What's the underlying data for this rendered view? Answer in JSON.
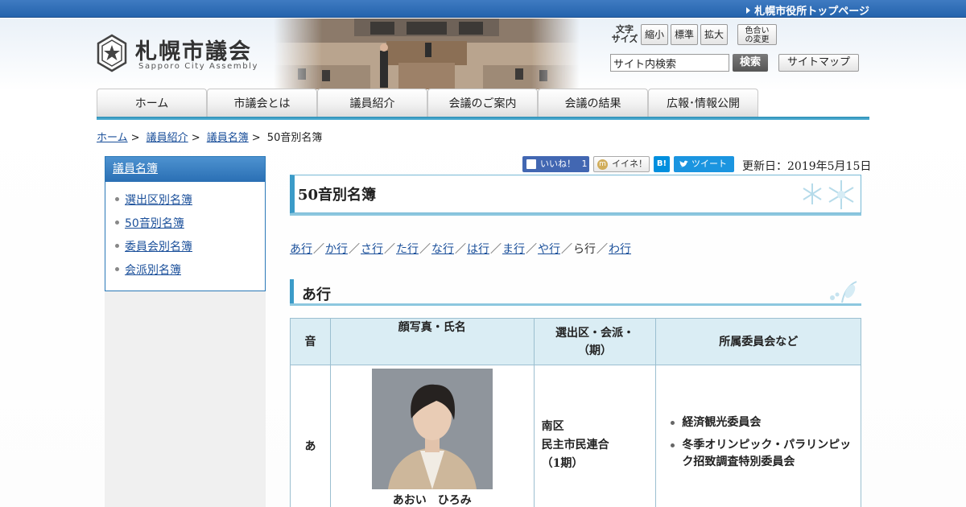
{
  "top_bar": {
    "link": "札幌市役所トップページ"
  },
  "logo": {
    "title": "札幌市議会",
    "subtitle": "Sapporo City Assembly"
  },
  "font_size": {
    "label": "文字\nサイズ",
    "small": "縮小",
    "standard": "標準",
    "large": "拡大",
    "color_change": "色合い\nの変更"
  },
  "search": {
    "value": "サイト内検索",
    "button": "検索",
    "sitemap": "サイトマップ"
  },
  "gnav": [
    "ホーム",
    "市議会とは",
    "議員紹介",
    "会議のご案内",
    "会議の結果",
    "広報･情報公開"
  ],
  "breadcrumb": {
    "items": [
      "ホーム",
      "議員紹介",
      "議員名簿"
    ],
    "current": "50音別名簿",
    "sep": ">"
  },
  "sidebar": {
    "head": "議員名簿",
    "items": [
      "選出区別名簿",
      "50音別名簿",
      "委員会別名簿",
      "会派別名簿"
    ]
  },
  "social": {
    "like": "いいね！",
    "like_count": "1",
    "mixi": "イイネ！",
    "hatena": "B!",
    "tweet": "ツイート"
  },
  "updated": "更新日：2019年5月15日",
  "page_title": "50音別名簿",
  "kana_nav": [
    "あ行",
    "か行",
    "さ行",
    "た行",
    "な行",
    "は行",
    "ま行",
    "や行",
    "ら行",
    "わ行"
  ],
  "kana_current_index": 8,
  "section_title": "あ行",
  "table": {
    "headers": [
      "音",
      "顔写真・氏名",
      "選出区・会派・\n（期）",
      "所属委員会など"
    ],
    "rows": [
      {
        "kana": "あ",
        "name": "あおい　ひろみ",
        "district": "南区",
        "faction": "民主市民連合",
        "term": "（1期）",
        "committees": [
          "経済観光委員会",
          "冬季オリンピック・パラリンピック招致調査特別委員会"
        ]
      }
    ]
  },
  "colors": {
    "accent": "#3b9bc8",
    "top_bar": "#2463ad",
    "header_blue": "#daedf4"
  }
}
